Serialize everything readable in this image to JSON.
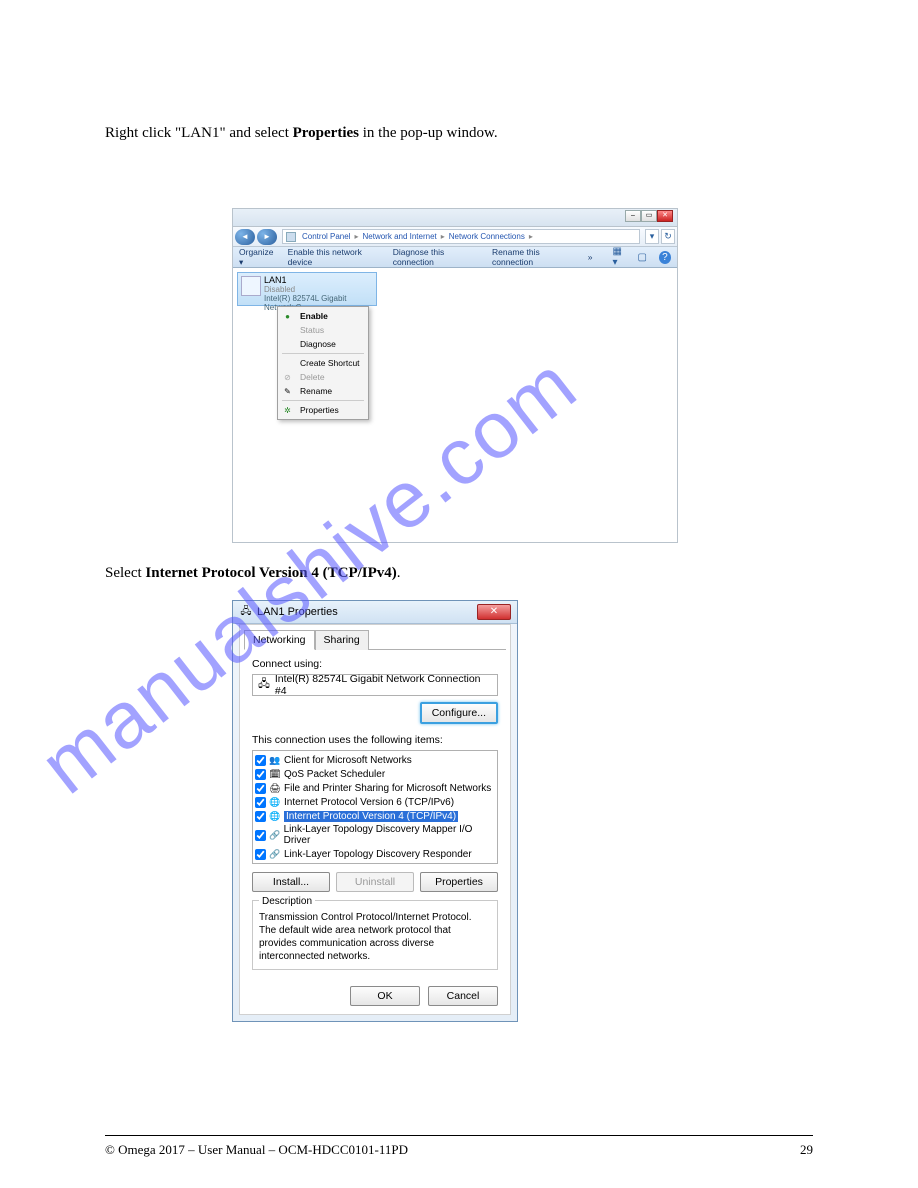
{
  "doc": {
    "top_text_prefix": "Right click \"LAN1\" and select ",
    "top_text_bold": "Properties",
    "top_text_suffix": " in the pop-up window.",
    "mid_text_prefix": "Select ",
    "mid_text_bold": "Internet Protocol Version 4 (TCP/IPv4)",
    "mid_text_suffix": ".",
    "footer_left": "© Omega 2017 – User Manual – OCM-HDCC0101-11PD",
    "footer_page": "29"
  },
  "watermark": "manualshive.com",
  "shot1": {
    "win_min_icon": "‒",
    "win_max_icon": "▭",
    "win_close_icon": "✕",
    "nav_back_icon": "◄",
    "nav_fwd_icon": "►",
    "breadcrumb": [
      "Control Panel",
      "Network and Internet",
      "Network Connections"
    ],
    "sep": "▸",
    "refresh_icon": "↻",
    "toolbar": {
      "organize": "Organize ▾",
      "enable": "Enable this network device",
      "diagnose": "Diagnose this connection",
      "rename": "Rename this connection",
      "more": "»",
      "view_icon": "▦ ▾",
      "pane_icon": "▢",
      "help_icon": "?"
    },
    "adapter": {
      "name": "LAN1",
      "status": "Disabled",
      "desc": "Intel(R) 82574L Gigabit Network C..."
    },
    "ctx": {
      "enable": "Enable",
      "status": "Status",
      "diagnose": "Diagnose",
      "shortcut": "Create Shortcut",
      "delete": "Delete",
      "rename": "Rename",
      "properties": "Properties",
      "enable_icon": "●",
      "delete_icon": "⊘",
      "rename_icon": "✎",
      "props_icon": "✲"
    }
  },
  "shot2": {
    "title": "LAN1 Properties",
    "close_icon": "✕",
    "network_icon": "🖧",
    "tabs": {
      "networking": "Networking",
      "sharing": "Sharing"
    },
    "connect_label": "Connect using:",
    "adapter_name": "Intel(R) 82574L Gigabit Network Connection #4",
    "adapter_icon": "🖧",
    "configure": "Configure...",
    "items_label": "This connection uses the following items:",
    "items": [
      {
        "icon": "👥",
        "label": "Client for Microsoft Networks"
      },
      {
        "icon": "🗓",
        "label": "QoS Packet Scheduler"
      },
      {
        "icon": "🖨",
        "label": "File and Printer Sharing for Microsoft Networks"
      },
      {
        "icon": "🌐",
        "label": "Internet Protocol Version 6 (TCP/IPv6)"
      },
      {
        "icon": "🌐",
        "label": "Internet Protocol Version 4 (TCP/IPv4)"
      },
      {
        "icon": "🔗",
        "label": "Link-Layer Topology Discovery Mapper I/O Driver"
      },
      {
        "icon": "🔗",
        "label": "Link-Layer Topology Discovery Responder"
      }
    ],
    "install": "Install...",
    "uninstall": "Uninstall",
    "properties": "Properties",
    "desc_legend": "Description",
    "desc_text": "Transmission Control Protocol/Internet Protocol. The default wide area network protocol that provides communication across diverse interconnected networks.",
    "ok": "OK",
    "cancel": "Cancel"
  }
}
